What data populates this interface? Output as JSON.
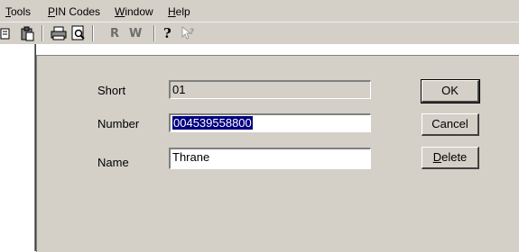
{
  "menu": {
    "items": [
      {
        "label": "Tools",
        "mnemonic": "T",
        "rest": "ools"
      },
      {
        "label": "PIN Codes",
        "mnemonic": "P",
        "rest": "IN Codes"
      },
      {
        "label": "Window",
        "mnemonic": "W",
        "rest": "indow"
      },
      {
        "label": "Help",
        "mnemonic": "H",
        "rest": "elp"
      }
    ]
  },
  "toolbar": {
    "icons": [
      "copy-icon",
      "paste-icon",
      "print-icon",
      "print-preview-icon",
      "r-icon",
      "w-icon",
      "help-icon",
      "context-help-icon"
    ],
    "r_label": "R",
    "w_label": "W"
  },
  "dialog": {
    "short": {
      "label": "Short",
      "value": "01"
    },
    "number": {
      "label": "Number",
      "value": "004539558800"
    },
    "name": {
      "label": "Name",
      "value": "Thrane"
    },
    "ok_label": "OK",
    "cancel_label": "Cancel",
    "delete": {
      "mnemonic": "D",
      "rest": "elete"
    }
  }
}
